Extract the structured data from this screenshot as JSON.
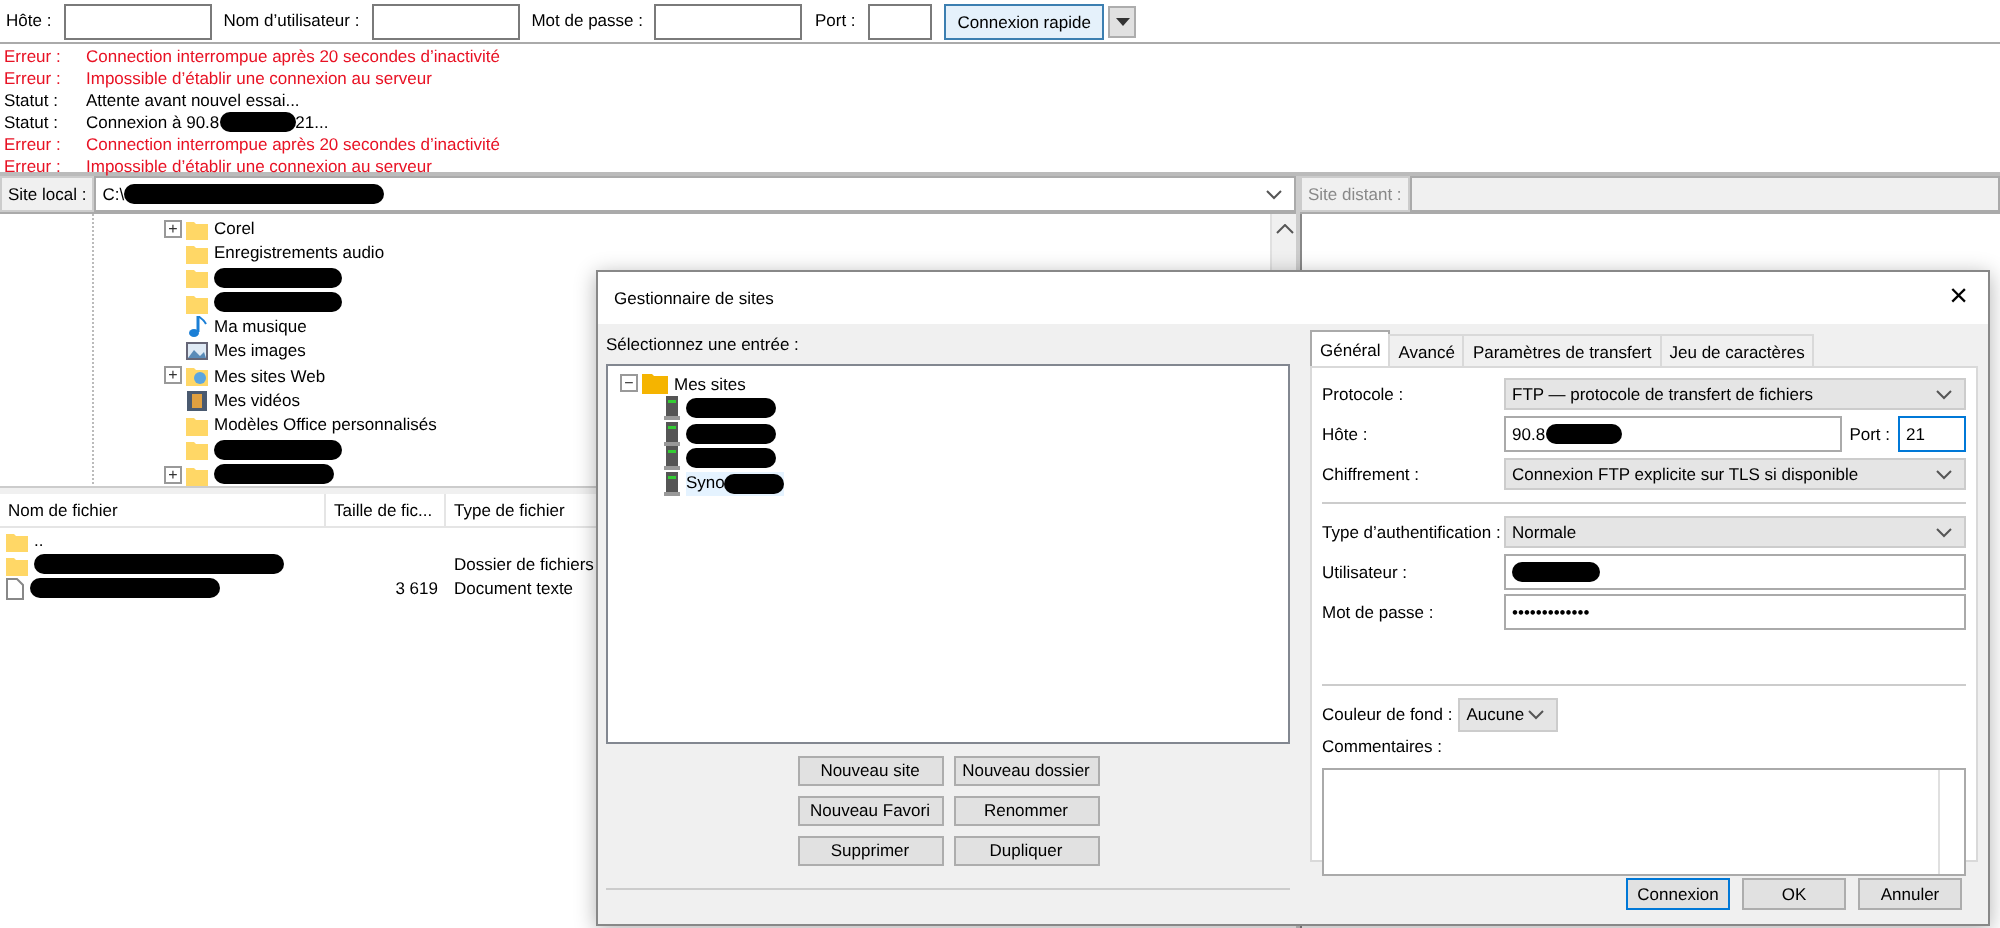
{
  "toolbar": {
    "fields": [
      {
        "label": "Hôte :"
      },
      {
        "label": "Nom d’utilisateur :"
      },
      {
        "label": "Mot de passe :"
      },
      {
        "label": "Port :"
      }
    ],
    "button": "Connexion rapide"
  },
  "log": [
    {
      "kind": "error",
      "label": "Erreur :",
      "message": "Connection interrompue après 20 secondes d’inactivité"
    },
    {
      "kind": "error",
      "label": "Erreur :",
      "message": "Impossible d’établir une connexion au serveur"
    },
    {
      "kind": "status",
      "label": "Statut :",
      "message": "Attente avant nouvel essai..."
    },
    {
      "kind": "status",
      "label": "Statut :",
      "message": "Connexion à 90.8",
      "redacted": true,
      "message_tail": "21..."
    },
    {
      "kind": "error",
      "label": "Erreur :",
      "message": "Connection interrompue après 20 secondes d’inactivité"
    },
    {
      "kind": "error",
      "label": "Erreur :",
      "message": "Impossible d’établir une connexion au serveur"
    }
  ],
  "local_site": {
    "label": "Site local :",
    "path": "C:\\",
    "redacted": true
  },
  "local_tree": [
    {
      "kind": "folder",
      "name": "Corel",
      "expander": "+"
    },
    {
      "kind": "folder",
      "name": "Enregistrements audio"
    },
    {
      "kind": "folder",
      "redacted": true
    },
    {
      "kind": "folder",
      "redacted": true
    },
    {
      "kind": "music",
      "name": "Ma musique"
    },
    {
      "kind": "images",
      "name": "Mes images"
    },
    {
      "kind": "web",
      "name": "Mes sites Web",
      "expander": "+"
    },
    {
      "kind": "videos",
      "name": "Mes vidéos"
    },
    {
      "kind": "folder",
      "name": "Modèles Office personnalisés"
    },
    {
      "kind": "folder",
      "redacted": true
    },
    {
      "kind": "folder",
      "redacted": true,
      "expander": "+"
    }
  ],
  "remote_site": {
    "label": "Site distant :"
  },
  "file_list": {
    "columns": [
      "Nom de fichier",
      "Taille de fic...",
      "Type de fichier"
    ],
    "rows": [
      {
        "kind": "folder",
        "name": ".."
      },
      {
        "kind": "folder",
        "redacted": true,
        "type": "Dossier de fichiers"
      },
      {
        "kind": "file",
        "redacted": true,
        "size": "3 619",
        "type": "Document texte"
      }
    ]
  },
  "dialog": {
    "title": "Gestionnaire de sites",
    "close": "×",
    "prompt": "Sélectionnez une entrée :",
    "tree": {
      "name": "Mes sites",
      "expander": "−",
      "children": [
        {
          "redacted": true,
          "selected": false
        },
        {
          "redacted": true,
          "selected": false
        },
        {
          "redacted": true,
          "selected": false
        },
        {
          "name": "Syno",
          "redacted": true,
          "selected": true
        }
      ]
    },
    "buttons": [
      "Nouveau site",
      "Nouveau dossier",
      "Nouveau Favori",
      "Renommer",
      "Supprimer",
      "Dupliquer"
    ],
    "tabs": [
      {
        "label": "Général",
        "selected": true
      },
      {
        "label": "Avancé",
        "selected": false
      },
      {
        "label": "Paramètres de transfert",
        "selected": false
      },
      {
        "label": "Jeu de caractères",
        "selected": false
      }
    ],
    "protocol": {
      "label": "Protocole :",
      "value": "FTP — protocole de transfert de fichiers"
    },
    "host": {
      "label": "Hôte :",
      "value": "90.8",
      "redacted": true
    },
    "port": {
      "label": "Port :",
      "value": "21"
    },
    "encryption": {
      "label": "Chiffrement :",
      "value": "Connexion FTP explicite sur TLS si disponible"
    },
    "auth_type": {
      "label": "Type d’authentification :",
      "value": "Normale"
    },
    "user": {
      "label": "Utilisateur :",
      "redacted": true
    },
    "password": {
      "label": "Mot de passe :",
      "value": "•••••••••••••"
    },
    "background_color": {
      "label": "Couleur de fond :",
      "value": "Aucune"
    },
    "comments": {
      "label": "Commentaires :"
    },
    "footer_buttons": [
      {
        "label": "Connexion",
        "default": true
      },
      {
        "label": "OK",
        "default": false
      },
      {
        "label": "Annuler",
        "default": false
      }
    ]
  }
}
